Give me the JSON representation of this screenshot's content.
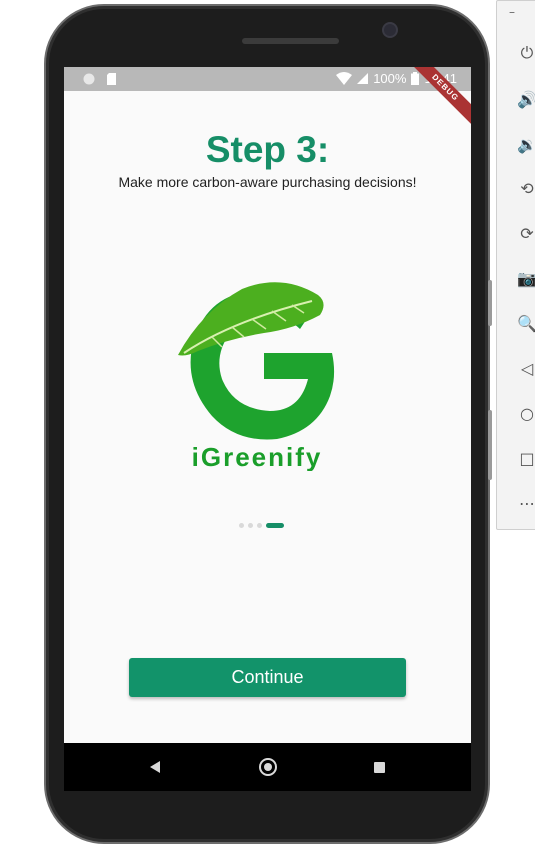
{
  "emulator_toolbar": {
    "minimize_label": "–",
    "buttons": [
      {
        "name": "power-icon",
        "glyph": "⏻"
      },
      {
        "name": "volume-up-icon",
        "glyph": "🔊"
      },
      {
        "name": "volume-down-icon",
        "glyph": "🔉"
      },
      {
        "name": "rotate-left-icon",
        "glyph": "⟲"
      },
      {
        "name": "rotate-right-icon",
        "glyph": "⟳"
      },
      {
        "name": "camera-icon",
        "glyph": "📷"
      },
      {
        "name": "zoom-icon",
        "glyph": "🔍"
      },
      {
        "name": "back-icon",
        "glyph": "◁"
      },
      {
        "name": "home-icon",
        "glyph": "○"
      },
      {
        "name": "overview-icon",
        "glyph": "□"
      },
      {
        "name": "more-icon",
        "glyph": "⋯"
      }
    ]
  },
  "statusbar": {
    "battery": "100%",
    "time": "10:41",
    "debug_banner": "DEBUG"
  },
  "onboarding": {
    "title": "Step 3:",
    "subtitle": "Make more carbon-aware purchasing decisions!",
    "logo_text": "iGreenify",
    "page_indicator": {
      "total": 4,
      "current": 4
    },
    "continue_label": "Continue"
  },
  "colors": {
    "accent": "#168e67",
    "button": "#12936a",
    "logo_green": "#1a9e2a"
  }
}
